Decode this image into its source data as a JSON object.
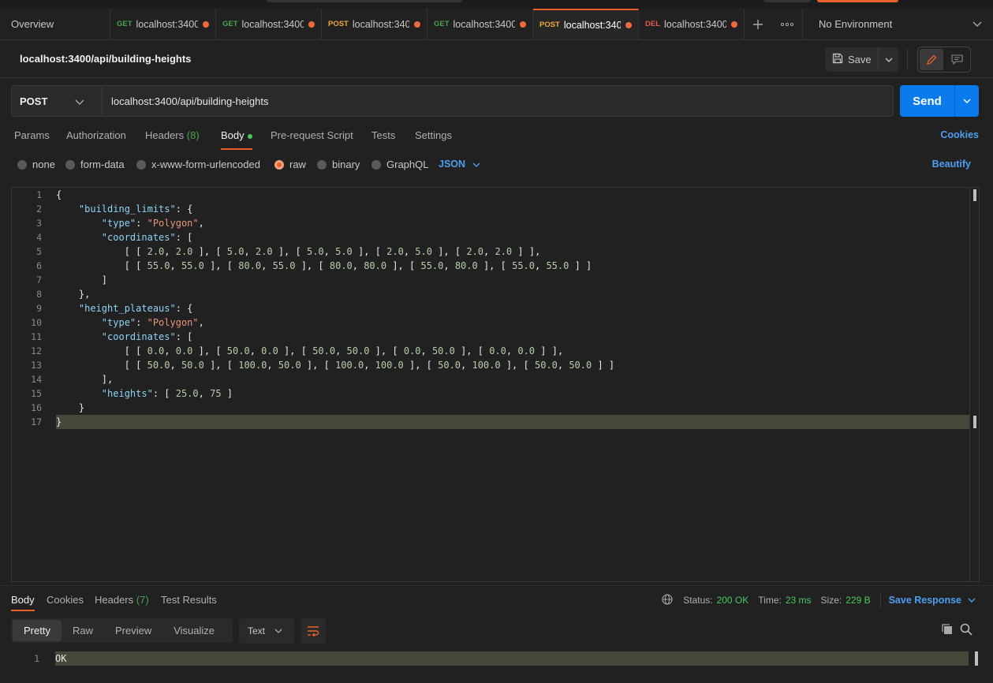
{
  "tabs": {
    "overview": "Overview",
    "items": [
      {
        "method": "GET",
        "url": "localhost:3400/"
      },
      {
        "method": "GET",
        "url": "localhost:3400/"
      },
      {
        "method": "POST",
        "url": "localhost:340("
      },
      {
        "method": "GET",
        "url": "localhost:3400/"
      },
      {
        "method": "POST",
        "url": "localhost:340(",
        "active": true
      },
      {
        "method": "DEL",
        "url": "localhost:3400/"
      }
    ],
    "environment": "No Environment"
  },
  "request": {
    "title": "localhost:3400/api/building-heights",
    "save_label": "Save",
    "method": "POST",
    "url": "localhost:3400/api/building-heights",
    "send_label": "Send"
  },
  "subtabs": {
    "params": "Params",
    "authorization": "Authorization",
    "headers": "Headers",
    "headers_count": "(8)",
    "body": "Body",
    "prerequest": "Pre-request Script",
    "tests": "Tests",
    "settings": "Settings",
    "cookies": "Cookies"
  },
  "body_options": {
    "none": "none",
    "form_data": "form-data",
    "urlencoded": "x-www-form-urlencoded",
    "raw": "raw",
    "binary": "binary",
    "graphql": "GraphQL",
    "format": "JSON",
    "beautify": "Beautify"
  },
  "editor": {
    "line_numbers": [
      "1",
      "2",
      "3",
      "4",
      "5",
      "6",
      "7",
      "8",
      "9",
      "10",
      "11",
      "12",
      "13",
      "14",
      "15",
      "16",
      "17"
    ]
  },
  "response": {
    "tabs": {
      "body": "Body",
      "cookies": "Cookies",
      "headers": "Headers",
      "headers_count": "(7)",
      "test_results": "Test Results"
    },
    "status_label": "Status:",
    "status_value": "200 OK",
    "time_label": "Time:",
    "time_value": "23 ms",
    "size_label": "Size:",
    "size_value": "229 B",
    "save_response": "Save Response",
    "formats": {
      "pretty": "Pretty",
      "raw": "Raw",
      "preview": "Preview",
      "visualize": "Visualize"
    },
    "text_type": "Text",
    "line_number": "1",
    "body_text": "OK"
  },
  "colors": {
    "accent": "#e8612c",
    "send": "#097bed",
    "link": "#4e9ef0",
    "status_ok": "#49c95e"
  }
}
